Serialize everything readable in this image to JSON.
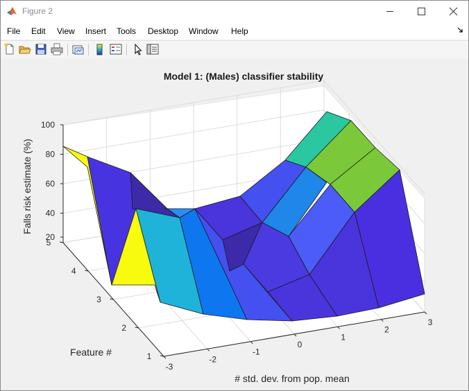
{
  "window": {
    "title": "Figure 2"
  },
  "menu": [
    "File",
    "Edit",
    "View",
    "Insert",
    "Tools",
    "Desktop",
    "Window",
    "Help"
  ],
  "toolbar_icons": [
    "new-figure-icon",
    "open-file-icon",
    "save-icon",
    "print-icon",
    "link-plot-icon",
    "insert-colorbar-icon",
    "insert-legend-icon",
    "edit-plot-icon",
    "property-inspector-icon"
  ],
  "chart_data": {
    "type": "surface",
    "title": "Model 1: (Males) classifier stability",
    "xlabel": "# std. dev. from pop. mean",
    "ylabel": "Feature #",
    "zlabel": "Falls risk estimate (%)",
    "x_ticks": [
      "-3",
      "-2",
      "-1",
      "0",
      "1",
      "2",
      "3"
    ],
    "y_ticks": [
      "1",
      "2",
      "3",
      "4",
      "5"
    ],
    "z_ticks": [
      "20",
      "40",
      "60",
      "80",
      "100"
    ],
    "colormap": "parula",
    "grid": true
  }
}
